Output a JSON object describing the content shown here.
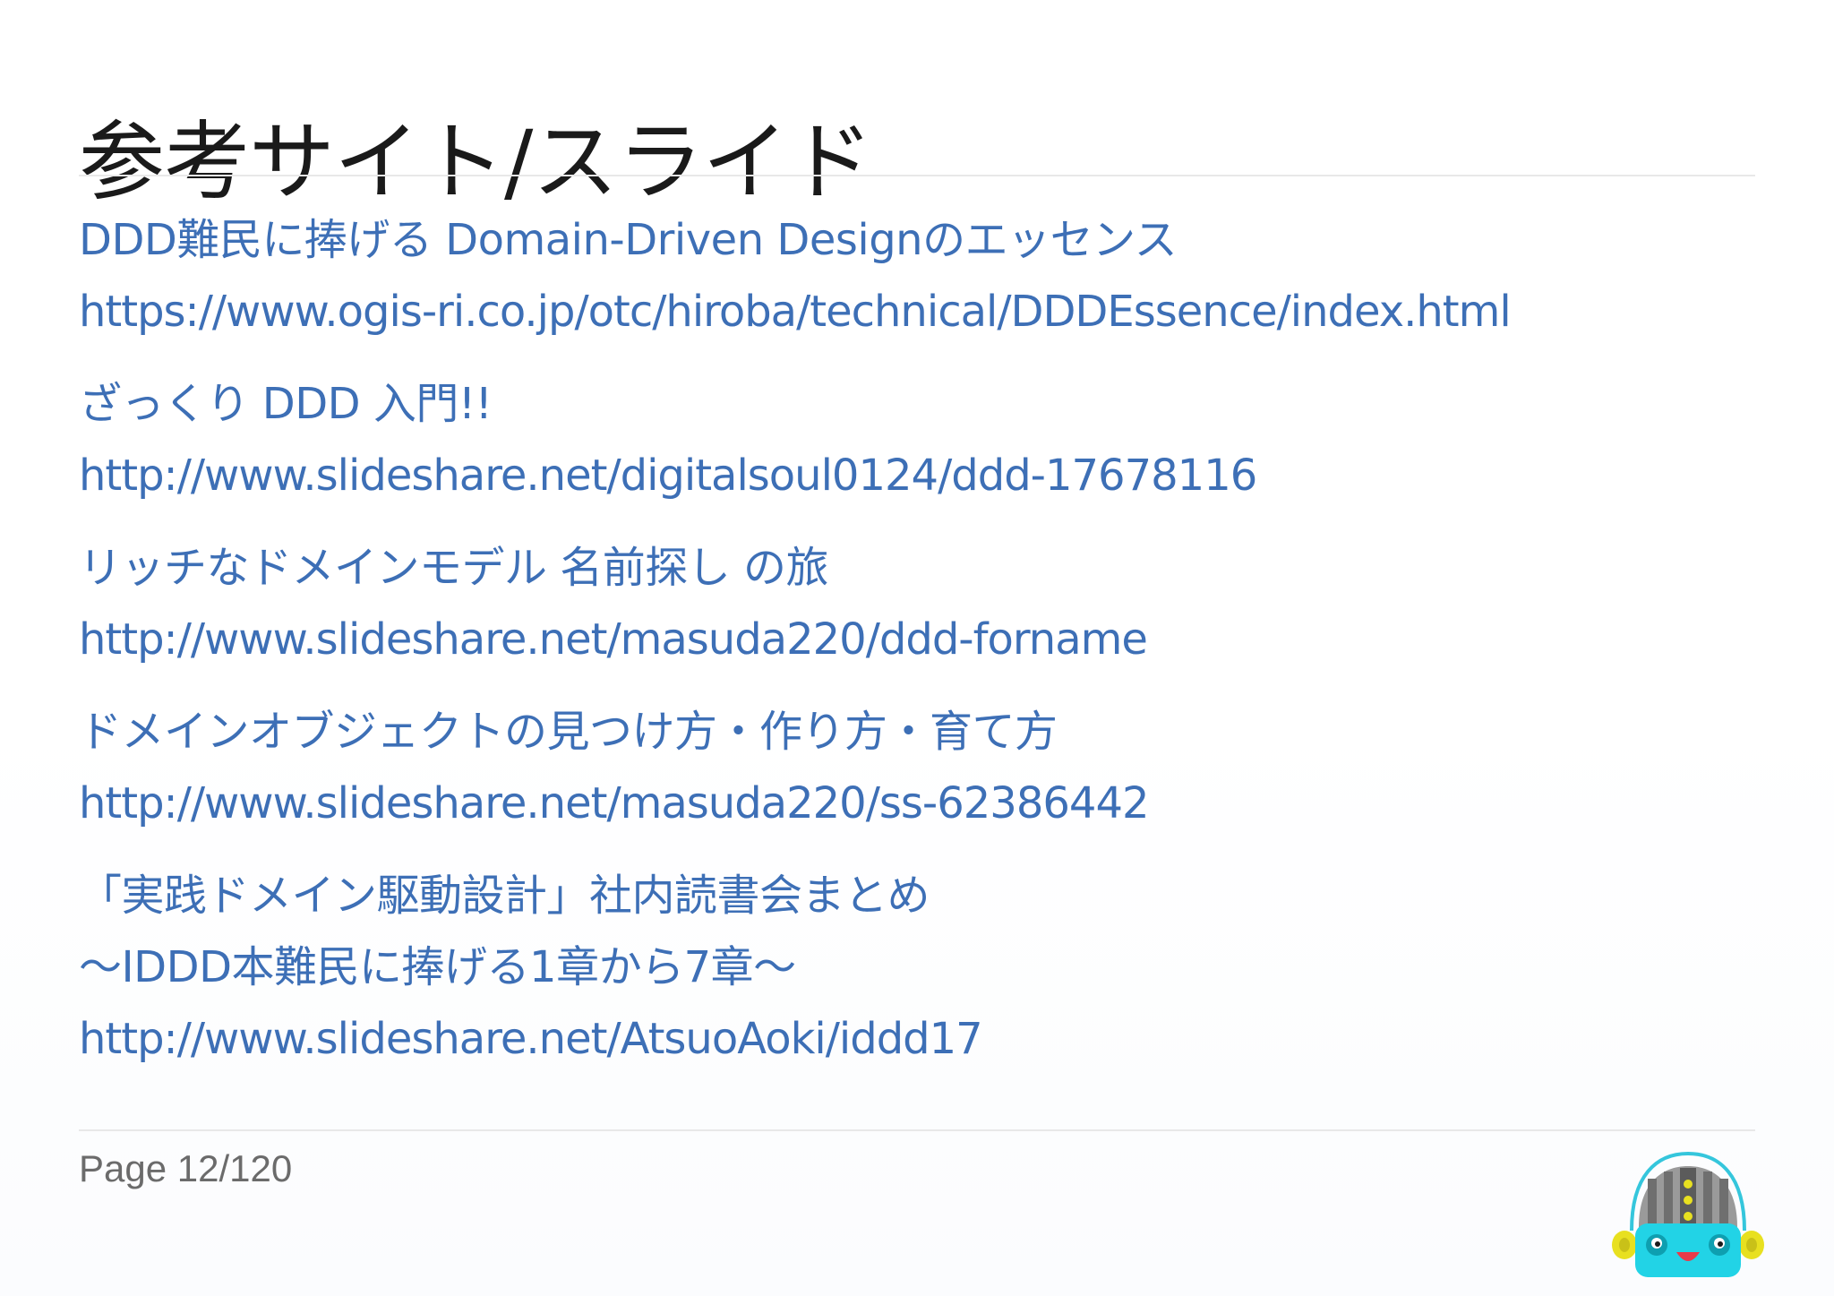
{
  "slide": {
    "title": "参考サイト/スライド",
    "references": [
      {
        "lines": [
          {
            "text": "DDD難民に捧げる Domain-Driven Designのエッセンス",
            "kind": "title"
          },
          {
            "text": "https://www.ogis-ri.co.jp/otc/hiroba/technical/DDDEssence/index.html",
            "kind": "url"
          }
        ]
      },
      {
        "lines": [
          {
            "text": "ざっくり DDD 入門!!",
            "kind": "title"
          },
          {
            "text": "http://www.slideshare.net/digitalsoul0124/ddd-17678116",
            "kind": "url"
          }
        ]
      },
      {
        "lines": [
          {
            "text": "リッチなドメインモデル 名前探し の旅",
            "kind": "title"
          },
          {
            "text": "http://www.slideshare.net/masuda220/ddd-forname",
            "kind": "url"
          }
        ]
      },
      {
        "lines": [
          {
            "text": "ドメインオブジェクトの見つけ方・作り方・育て方",
            "kind": "title"
          },
          {
            "text": "http://www.slideshare.net/masuda220/ss-62386442",
            "kind": "url"
          }
        ]
      },
      {
        "lines": [
          {
            "text": "「実践ドメイン駆動設計」社内読書会まとめ",
            "kind": "title"
          },
          {
            "text": "〜IDDD本難民に捧げる1章から7章〜",
            "kind": "title"
          },
          {
            "text": "http://www.slideshare.net/AtsuoAoki/iddd17",
            "kind": "url"
          }
        ]
      }
    ],
    "footer": {
      "page_label": "Page 12/120"
    }
  },
  "colors": {
    "link": "#3d6fb6",
    "title": "#1a1a1a",
    "footer_text": "#6b6b6b",
    "rule": "#e8e8e8",
    "mascot_face": "#22d3e6",
    "mascot_helmet": "#8c8c8c",
    "mascot_ears": "#e8e020"
  },
  "icons": {
    "mascot": "robot-mascot-icon"
  }
}
